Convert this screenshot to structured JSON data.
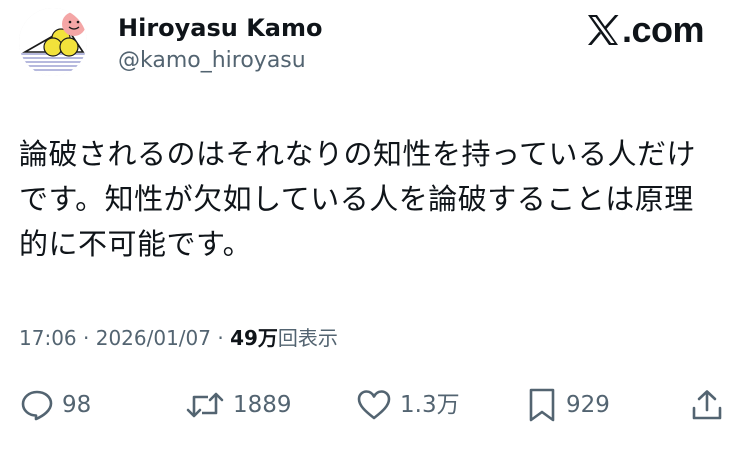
{
  "author": {
    "name": "Hiroyasu Kamo",
    "handle": "@kamo_hiroyasu"
  },
  "brand": {
    "text": ".com",
    "logo_icon": "x-logo-icon"
  },
  "tweet": {
    "text": "論破されるのはそれなりの知性を持っている人だけ\nです。知性が欠如している人を論破することは原理\n的に不可能です。"
  },
  "meta": {
    "time": "17:06",
    "separator": " · ",
    "date": "2026/01/07",
    "views": "49万",
    "views_label": "回表示"
  },
  "actions": {
    "reply": {
      "icon": "reply-icon",
      "count": "98"
    },
    "retweet": {
      "icon": "retweet-icon",
      "count": "1889"
    },
    "like": {
      "icon": "heart-icon",
      "count": "1.3万"
    },
    "bookmark": {
      "icon": "bookmark-icon",
      "count": "929"
    },
    "share": {
      "icon": "share-icon"
    }
  },
  "colors": {
    "text_primary": "#0f1419",
    "text_secondary": "#536471",
    "avatar_face": "#f4a6a6",
    "avatar_circles": "#f2e23b",
    "avatar_lines": "#8a8fc9"
  }
}
